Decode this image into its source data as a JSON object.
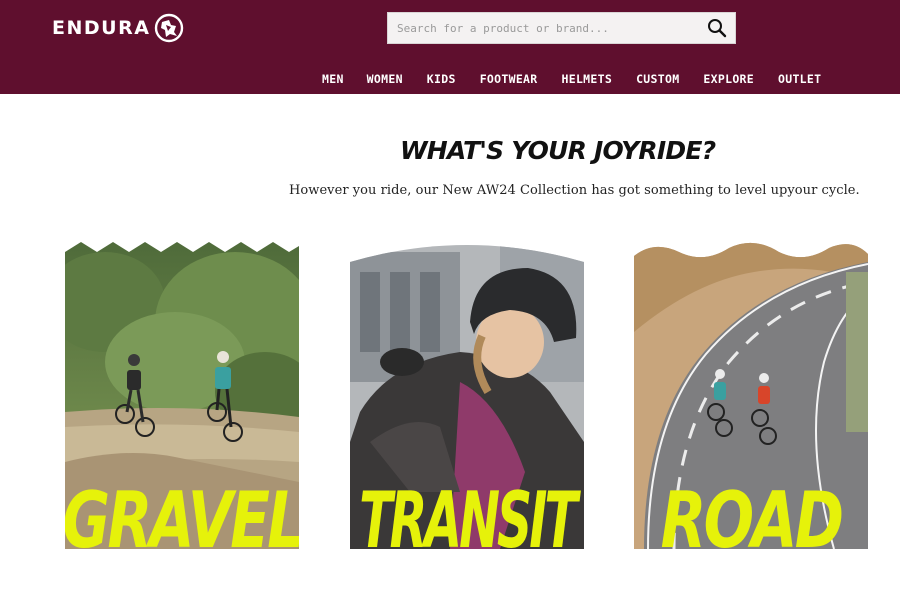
{
  "brand": {
    "name": "ENDURA",
    "color": "#5f0f2e",
    "accent": "#e6f20a"
  },
  "search": {
    "placeholder": "Search for a product or brand...",
    "value": "",
    "icon": "search-icon"
  },
  "nav": {
    "items": [
      {
        "label": "MEN"
      },
      {
        "label": "WOMEN"
      },
      {
        "label": "KIDS"
      },
      {
        "label": "FOOTWEAR"
      },
      {
        "label": "HELMETS"
      },
      {
        "label": "CUSTOM"
      },
      {
        "label": "EXPLORE"
      },
      {
        "label": "OUTLET"
      }
    ]
  },
  "hero": {
    "headline": "WHAT'S YOUR JOYRIDE?",
    "subline": "However you ride, our New AW24 Collection has got something to level upyour cycle."
  },
  "cards": [
    {
      "label": "GRAVEL"
    },
    {
      "label": "TRANSIT"
    },
    {
      "label": "ROAD"
    }
  ]
}
